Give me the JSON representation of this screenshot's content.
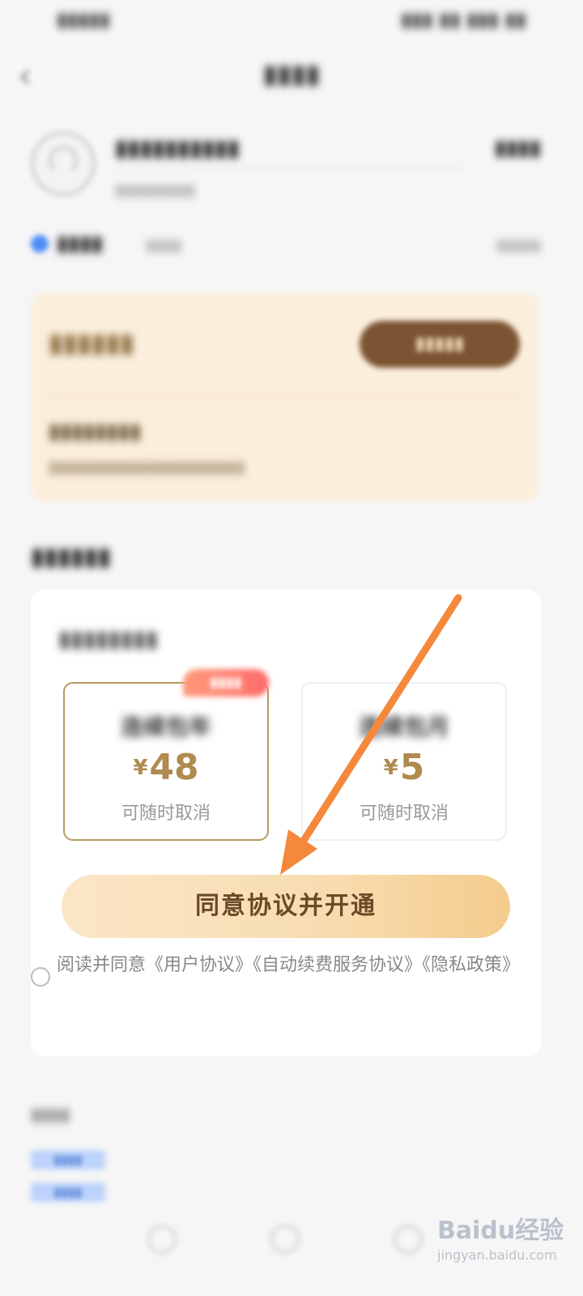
{
  "plans": [
    {
      "name": "连续包年",
      "currency": "¥",
      "price": "48",
      "note": "可随时取消",
      "selected": true
    },
    {
      "name": "连续包月",
      "currency": "¥",
      "price": "5",
      "note": "可随时取消",
      "selected": false
    }
  ],
  "agree_button": "同意协议并开通",
  "agreement_text": "阅读并同意《用户协议》《自动续费服务协议》《隐私政策》",
  "watermark": {
    "logo": "Baidu经验",
    "url": "jingyan.baidu.com"
  },
  "colors": {
    "accent_gold": "#b08a4e",
    "button_gradient_start": "#fae6c6",
    "button_gradient_end": "#f4cc8c",
    "arrow": "#f5883b"
  }
}
